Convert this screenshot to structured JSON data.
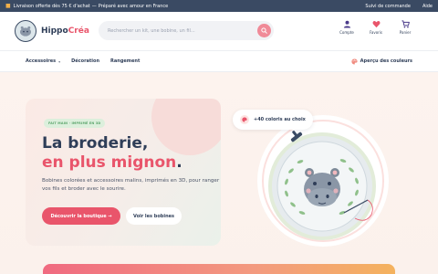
{
  "topbar": {
    "promo": "Livraison offerte dès 75 € d'achat",
    "separator": "—",
    "tagline": "Préparé avec amour en France",
    "links": [
      "Suivi de commande",
      "Aide"
    ]
  },
  "header": {
    "brand_main": "Hippo",
    "brand_accent": "Créa",
    "search_placeholder": "Rechercher un kit, une bobine, un fil...",
    "icons": [
      {
        "label": "Compte",
        "icon": "user-icon"
      },
      {
        "label": "Favoris",
        "icon": "heart-icon"
      },
      {
        "label": "Panier",
        "icon": "cart-icon"
      }
    ]
  },
  "nav": {
    "items": [
      "Accessoires",
      "Décoration",
      "Rangement"
    ],
    "colors_link": "Aperçu des couleurs"
  },
  "hero": {
    "tag": "FAIT MAIN · IMPRIMÉ EN 3D",
    "headline_line1": "La broderie,",
    "headline_line2": "en plus mignon",
    "headline_dot": ".",
    "description": "Bobines colorées et accessoires malins, imprimés en 3D, pour ranger vos fils et broder avec le sourire.",
    "cta_primary": "Découvrir la boutique →",
    "cta_secondary": "Voir les bobines",
    "colors_badge": "+40 coloris au choix"
  },
  "colors": {
    "navy": "#2f3e58",
    "topbar": "#3a4a63",
    "pink": "#e9556b",
    "hero_bg": "#fdf3ee",
    "tag_green": "#5aa46a"
  }
}
